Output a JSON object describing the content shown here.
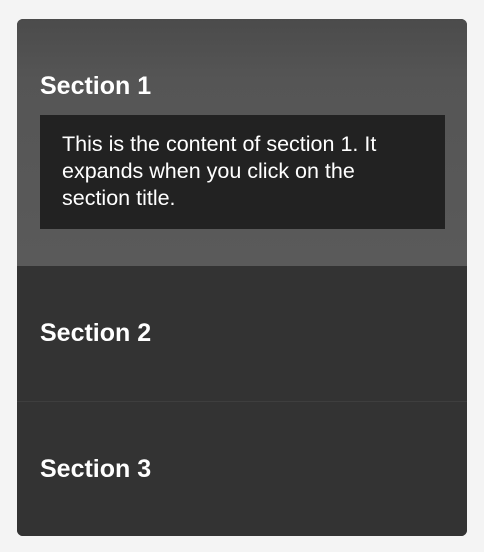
{
  "accordion": {
    "sections": [
      {
        "title": "Section 1",
        "content": "This is the content of section 1. It expands when you click on the section title.",
        "expanded": true
      },
      {
        "title": "Section 2",
        "expanded": false
      },
      {
        "title": "Section 3",
        "expanded": false
      }
    ]
  },
  "colors": {
    "page_background": "#f4f4f4",
    "section_background": "#333333",
    "expanded_section_background": "#585858",
    "content_background": "#222222",
    "text": "#ffffff"
  }
}
